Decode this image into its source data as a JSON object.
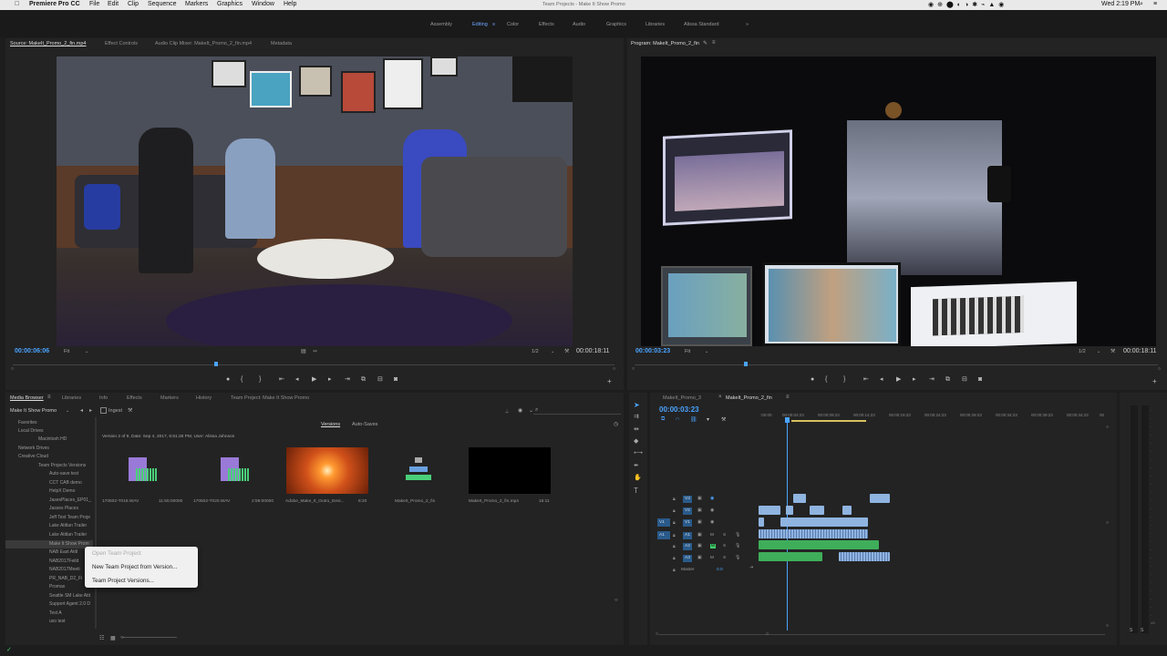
{
  "menubar": {
    "app": "Premiere Pro CC",
    "items": [
      "File",
      "Edit",
      "Clip",
      "Sequence",
      "Markers",
      "Graphics",
      "Window",
      "Help"
    ],
    "window_title": "Team Projects - Make It Show Promo",
    "clock": "Wed 2:19 PM"
  },
  "workspaces": [
    "Assembly",
    "Editing",
    "Color",
    "Effects",
    "Audio",
    "Graphics",
    "Libraries",
    "Alissa Standard"
  ],
  "workspace_active": "Editing",
  "workspace_more": "»",
  "source": {
    "tabs": [
      "Source: MakeIt_Promo_2_fin.mp4",
      "Effect Controls",
      "Audio Clip Mixer: MakeIt_Promo_2_fin.mp4",
      "Metadata"
    ],
    "timecode": "00:00:06:06",
    "fit": "Fit",
    "resolution": "1/2",
    "duration": "00:00:18:11"
  },
  "program": {
    "title": "Program: MakeIt_Promo_2_fin",
    "timecode": "00:00:03:23",
    "fit": "Fit",
    "resolution": "1/2",
    "duration": "00:00:18:11"
  },
  "project": {
    "tabs": [
      "Media Browser",
      "Libraries",
      "Info",
      "Effects",
      "Markers",
      "History",
      "Team Project: Make It Show Promo"
    ],
    "location": "Make It Show Promo",
    "ingest": "Ingest",
    "subtabs": [
      "Versions",
      "Auto-Saves"
    ],
    "version_info": "Version 2 of 9, Date: Sep 4, 2017, 6:51:26 PM, User: Alissa Johnson",
    "tree": [
      "Favorites",
      "Local Drives",
      "Macintosh HD",
      "Network Drives",
      "Creative Cloud",
      "Team Projects Versions",
      "Auto-save test",
      "CCT CAB demo",
      "HelpX Demo",
      "JasesPlaces_EP01_",
      "Jasses Places",
      "Jeff Test Team Proje",
      "Lake Atitlan Trailer",
      "Lake Atitlan Trailer",
      "Make It Show Prom",
      "NAB East Atitl",
      "NAB2017Feild",
      "NAB2017Meeti",
      "PR_NAB_D2_Fi",
      "Promax",
      "Seattle SM Lake Atit",
      "Support Agent 2.0 D",
      "Test A",
      "uxo test"
    ],
    "assets": [
      {
        "name": "170502-T018.WAV",
        "dur": "11:55:00000"
      },
      {
        "name": "170502-T020.WAV",
        "dur": "2:59:00000"
      },
      {
        "name": "Adobe_Make_It_Outro_Desi...",
        "dur": "8:20"
      },
      {
        "name": "MakeIt_Promo_2_fin",
        "dur": ""
      },
      {
        "name": "MakeIt_Promo_2_fin.mp4",
        "dur": "15:11"
      }
    ]
  },
  "context_menu": {
    "items": [
      "Open Team Project",
      "New Team Project from Version...",
      "Team Project Versions..."
    ]
  },
  "timeline": {
    "tabs": [
      "MakeIt_Promo_3",
      "MakeIt_Promo_2_fin"
    ],
    "timecode": "00:00:03:23",
    "ruler": [
      ":00:00",
      "00:00:04:23",
      "00:00:09:23",
      "00:00:14:23",
      "00:00:19:23",
      "00:00:24:23",
      "00:00:29:23",
      "00:00:34:23",
      "00:00:39:23",
      "00:00:44:23",
      "00"
    ],
    "tracks_video": [
      "V3",
      "V2",
      "V1"
    ],
    "tracks_audio": [
      "A1",
      "A2",
      "A3"
    ],
    "master": "Master",
    "master_val": "0.0"
  },
  "colors": {
    "accent": "#4aa3ff",
    "video_clip": "#8fb4e0",
    "audio_clip": "#3fae5a"
  }
}
